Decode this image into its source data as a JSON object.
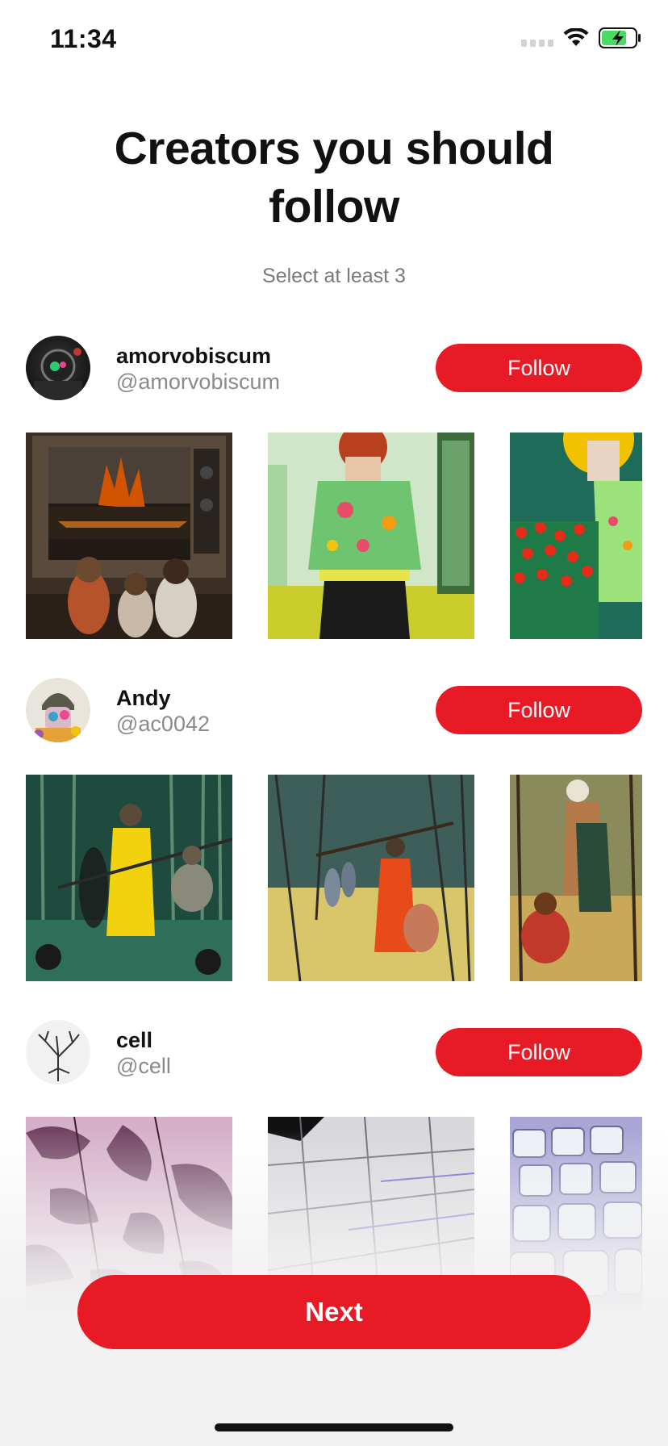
{
  "status_bar": {
    "time": "11:34",
    "battery_level": 0.75,
    "battery_charging": true,
    "icons": [
      "signal-icon",
      "wifi-icon",
      "battery-charging-icon"
    ]
  },
  "header": {
    "title": "Creators you should follow",
    "subtitle": "Select at least 3"
  },
  "creators": [
    {
      "name": "amorvobiscum",
      "handle": "@amorvobiscum",
      "follow_label": "Follow",
      "artworks": [
        "children watching burning landscape on vintage TV",
        "floral green dress on mannequin in gallery",
        "mannequin with yellow hat among red poppies"
      ]
    },
    {
      "name": "Andy",
      "handle": "@ac0042",
      "follow_label": "Follow",
      "artworks": [
        "figure in yellow robe in bamboo forest",
        "figure in red robe in forest",
        "figures in forest clearing"
      ]
    },
    {
      "name": "cell",
      "handle": "@cell",
      "follow_label": "Follow",
      "artworks": [
        "purple foliage abstract",
        "ceiling panels grid",
        "keyboard keys close-up"
      ]
    }
  ],
  "footer": {
    "next_label": "Next"
  },
  "colors": {
    "accent": "#e81a25",
    "subtitle": "#7a7a7a",
    "handle": "#8a8a8a",
    "battery_green": "#4cd964"
  }
}
